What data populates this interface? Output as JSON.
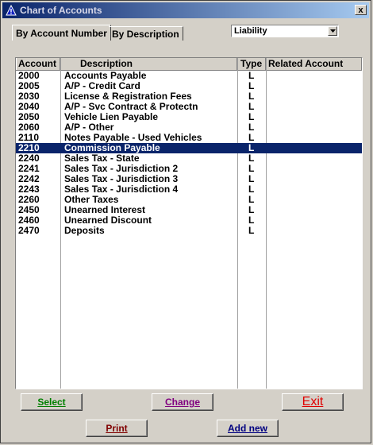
{
  "window": {
    "title": "Chart of Accounts",
    "close_glyph": "x"
  },
  "tabs": [
    {
      "label": "By Account Number",
      "active": true
    },
    {
      "label": "By Description",
      "active": false
    }
  ],
  "filter": {
    "selected": "Liability"
  },
  "table": {
    "headers": {
      "account": "Account",
      "description": "Description",
      "type": "Type",
      "related": "Related Account"
    },
    "rows": [
      {
        "account": "2000",
        "description": "Accounts Payable",
        "type": "L",
        "related": ""
      },
      {
        "account": "2005",
        "description": "A/P - Credit Card",
        "type": "L",
        "related": ""
      },
      {
        "account": "2030",
        "description": "License & Registration Fees",
        "type": "L",
        "related": ""
      },
      {
        "account": "2040",
        "description": "A/P - Svc Contract & Protectn",
        "type": "L",
        "related": ""
      },
      {
        "account": "2050",
        "description": "Vehicle Lien Payable",
        "type": "L",
        "related": ""
      },
      {
        "account": "2060",
        "description": "A/P - Other",
        "type": "L",
        "related": ""
      },
      {
        "account": "2110",
        "description": "Notes Payable - Used Vehicles",
        "type": "L",
        "related": ""
      },
      {
        "account": "2210",
        "description": "Commission Payable",
        "type": "L",
        "related": "",
        "selected": true
      },
      {
        "account": "2240",
        "description": "Sales Tax - State",
        "type": "L",
        "related": ""
      },
      {
        "account": "2241",
        "description": "Sales Tax - Jurisdiction 2",
        "type": "L",
        "related": ""
      },
      {
        "account": "2242",
        "description": "Sales Tax - Jurisdiction 3",
        "type": "L",
        "related": ""
      },
      {
        "account": "2243",
        "description": "Sales Tax - Jurisdiction 4",
        "type": "L",
        "related": ""
      },
      {
        "account": "2260",
        "description": "Other Taxes",
        "type": "L",
        "related": ""
      },
      {
        "account": "2450",
        "description": "Unearned Interest",
        "type": "L",
        "related": ""
      },
      {
        "account": "2460",
        "description": "Unearned Discount",
        "type": "L",
        "related": ""
      },
      {
        "account": "2470",
        "description": "Deposits",
        "type": "L",
        "related": ""
      }
    ]
  },
  "buttons": {
    "select": {
      "label": "Select",
      "color": "#008000"
    },
    "change": {
      "label": "Change",
      "color": "#800080"
    },
    "exit": {
      "label": "Exit",
      "color": "#e00000"
    },
    "print": {
      "label": "Print",
      "color": "#800000"
    },
    "add_new": {
      "label": "Add new",
      "color": "#000080"
    }
  },
  "colors": {
    "title_bar": "#0a246a",
    "selection": "#0a246a",
    "face": "#d4d0c8"
  },
  "icons": {
    "app": "warning-triangle-icon",
    "dropdown": "triangle-down-icon"
  }
}
